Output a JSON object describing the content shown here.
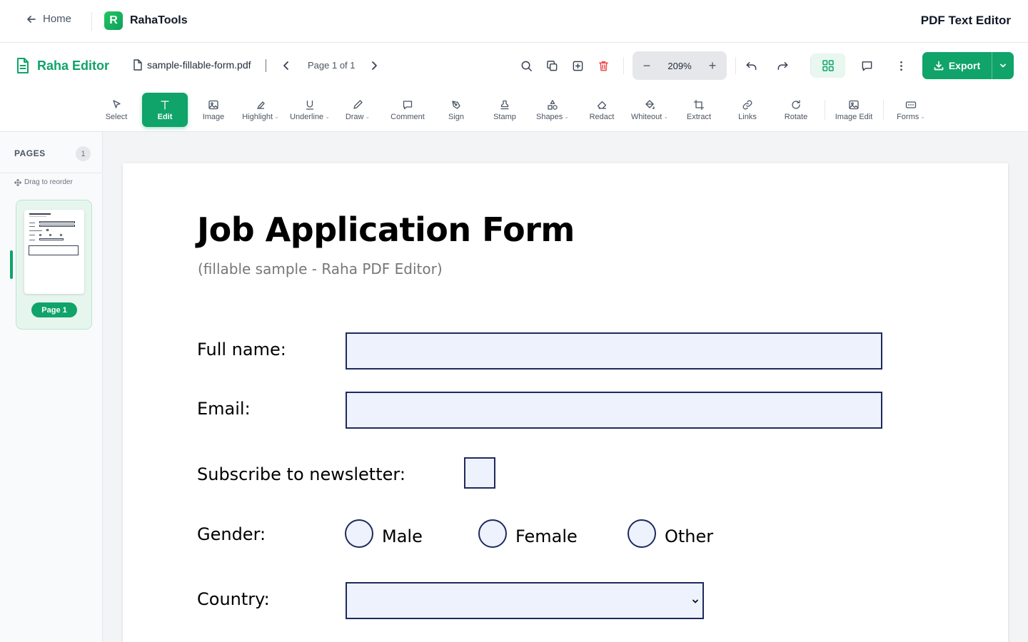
{
  "header": {
    "home_label": "Home",
    "brand_name": "RahaTools",
    "brand_logo_letter": "R",
    "page_heading": "PDF Text Editor"
  },
  "editor": {
    "brand_name": "Raha Editor",
    "file_name": "sample-fillable-form.pdf",
    "page_indicator": "Page 1 of 1",
    "zoom": "209%",
    "export_label": "Export",
    "accent_color": "#10a36a",
    "danger_color": "#ef4444"
  },
  "tools": [
    {
      "label": "Select",
      "icon": "cursor-icon",
      "dropdown": false,
      "active": false
    },
    {
      "label": "Edit",
      "icon": "text-t-icon",
      "dropdown": false,
      "active": true
    },
    {
      "label": "Image",
      "icon": "image-icon",
      "dropdown": false,
      "active": false
    },
    {
      "label": "Highlight",
      "icon": "highlighter-icon",
      "dropdown": true,
      "active": false
    },
    {
      "label": "Underline",
      "icon": "underline-icon",
      "dropdown": true,
      "active": false
    },
    {
      "label": "Draw",
      "icon": "pencil-icon",
      "dropdown": true,
      "active": false
    },
    {
      "label": "Comment",
      "icon": "comment-icon",
      "dropdown": false,
      "active": false
    },
    {
      "label": "Sign",
      "icon": "pen-nib-icon",
      "dropdown": false,
      "active": false
    },
    {
      "label": "Stamp",
      "icon": "stamp-icon",
      "dropdown": false,
      "active": false
    },
    {
      "label": "Shapes",
      "icon": "shapes-icon",
      "dropdown": true,
      "active": false
    },
    {
      "label": "Redact",
      "icon": "eraser-icon",
      "dropdown": false,
      "active": false
    },
    {
      "label": "Whiteout",
      "icon": "paint-bucket-icon",
      "dropdown": true,
      "active": false
    },
    {
      "label": "Extract",
      "icon": "crop-icon",
      "dropdown": false,
      "active": false
    },
    {
      "label": "Links",
      "icon": "link-icon",
      "dropdown": false,
      "active": false
    },
    {
      "label": "Rotate",
      "icon": "rotate-icon",
      "dropdown": false,
      "active": false
    },
    {
      "label": "Image Edit",
      "icon": "image-edit-icon",
      "dropdown": false,
      "active": false
    },
    {
      "label": "Forms",
      "icon": "form-field-icon",
      "dropdown": true,
      "active": false
    }
  ],
  "sidebar": {
    "title": "PAGES",
    "count": "1",
    "drag_hint": "Drag to reorder",
    "pages": [
      {
        "label": "Page 1"
      }
    ],
    "thumbnail_title": "Job Application Form"
  },
  "document": {
    "title": "Job Application Form",
    "subtitle": "(fillable sample - Raha PDF Editor)",
    "fields": {
      "full_name_label": "Full name:",
      "full_name_value": "",
      "email_label": "Email:",
      "email_value": "",
      "newsletter_label": "Subscribe to newsletter:",
      "newsletter_checked": false,
      "gender_label": "Gender:",
      "gender_options": [
        "Male",
        "Female",
        "Other"
      ],
      "country_label": "Country:",
      "country_value": ""
    },
    "field_fill_color": "#eef2fd",
    "field_border_color": "#1e2a5e"
  }
}
